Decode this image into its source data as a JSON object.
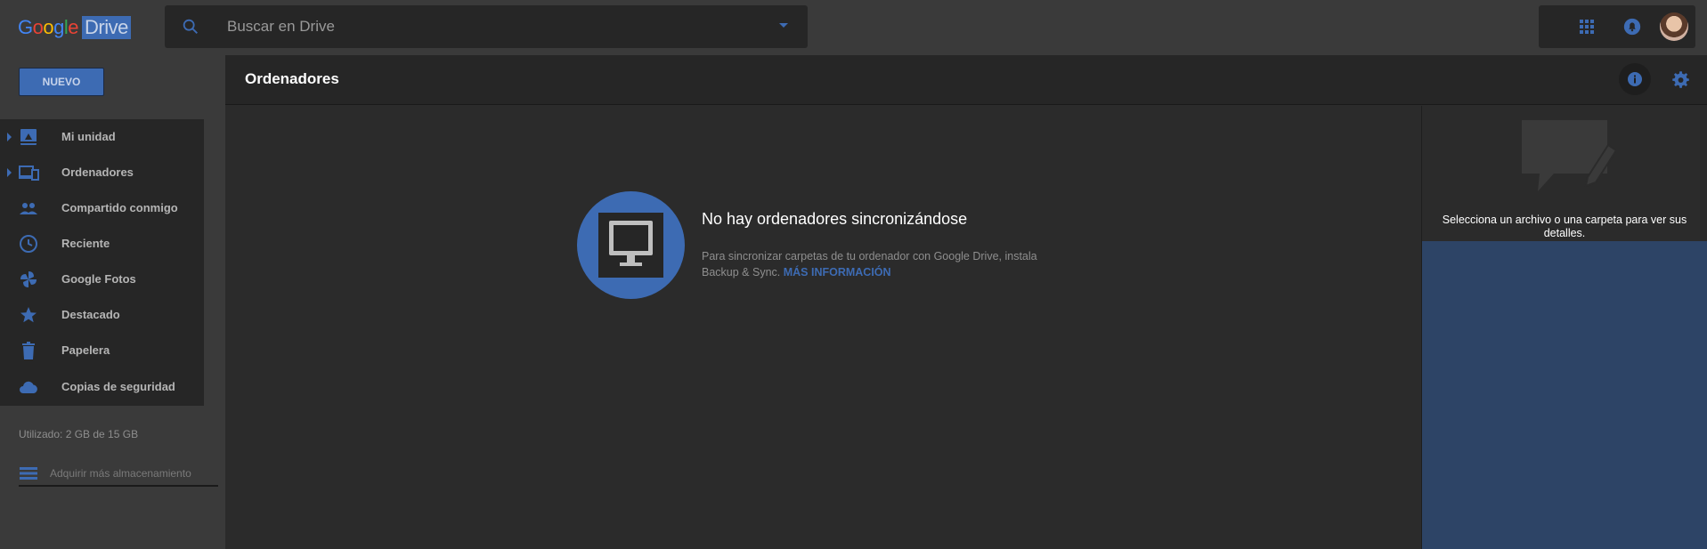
{
  "app": {
    "logo_google_letters": [
      "G",
      "o",
      "o",
      "g",
      "l",
      "e"
    ],
    "logo_product": "Drive"
  },
  "search": {
    "placeholder": "Buscar en Drive"
  },
  "sidebar": {
    "new_label": "NUEVO",
    "items": [
      {
        "label": "Mi unidad",
        "icon": "drive-icon",
        "expandable": true
      },
      {
        "label": "Ordenadores",
        "icon": "computers-icon",
        "expandable": true
      },
      {
        "label": "Compartido conmigo",
        "icon": "people-icon",
        "expandable": false
      },
      {
        "label": "Reciente",
        "icon": "clock-icon",
        "expandable": false
      },
      {
        "label": "Google Fotos",
        "icon": "pinwheel-icon",
        "expandable": false
      },
      {
        "label": "Destacado",
        "icon": "star-icon",
        "expandable": false
      },
      {
        "label": "Papelera",
        "icon": "trash-icon",
        "expandable": false
      },
      {
        "label": "Copias de seguridad",
        "icon": "cloud-icon",
        "expandable": false
      }
    ],
    "storage_used": "Utilizado: 2 GB de 15 GB",
    "buy_storage": "Adquirir más almacenamiento"
  },
  "header": {
    "title": "Ordenadores"
  },
  "main": {
    "empty_title": "No hay ordenadores sincronizándose",
    "empty_desc": "Para sincronizar carpetas de tu ordenador con Google Drive, instala Backup & Sync.",
    "empty_link": "MÁS INFORMACIÓN"
  },
  "details": {
    "text": "Selecciona un archivo o una carpeta para ver sus detalles."
  },
  "colors": {
    "accent": "#3d6bb3",
    "background": "#2b2b2b",
    "panel": "#262626",
    "chrome": "#3a3a3a"
  }
}
